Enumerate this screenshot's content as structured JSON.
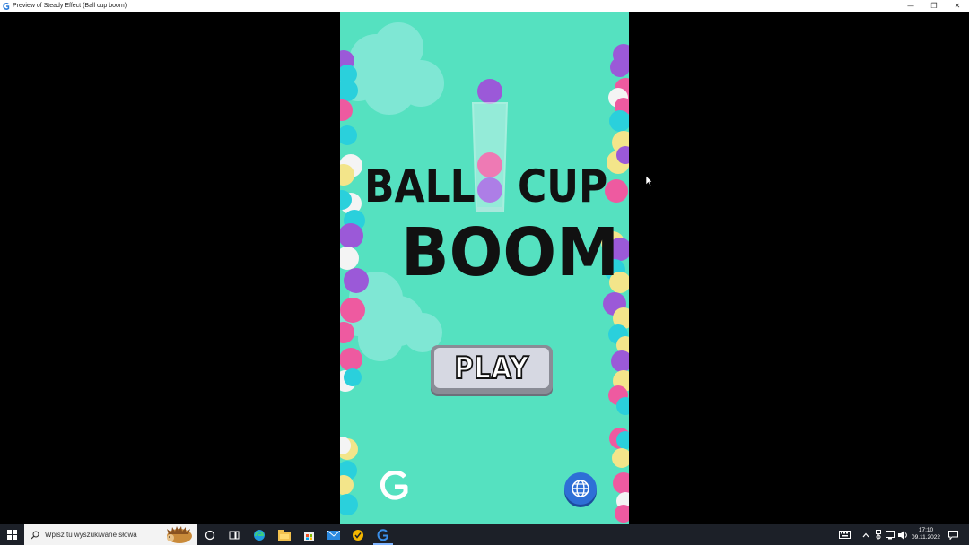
{
  "window": {
    "title": "Preview of Steady Effect (Ball cup boom)",
    "controls": {
      "minimize": "—",
      "restore": "❐",
      "close": "✕"
    }
  },
  "game": {
    "logo": {
      "word1": "BALL",
      "word2": "CUP",
      "word3": "BOOM"
    },
    "play_label": "PLAY",
    "icons": {
      "brand": "g-logo-icon",
      "language": "globe-icon"
    },
    "colors": {
      "background": "#55e1c0",
      "pink": "#ee5aa0",
      "purple": "#9b59d8",
      "cyan": "#2ad0dc",
      "yellow": "#f3e58a",
      "white": "#f4f4f4"
    }
  },
  "taskbar": {
    "search_placeholder": "Wpisz tu wyszukiwane słowa",
    "time": "17:10",
    "date": "09.11.2022",
    "icons": [
      "windows-start-icon",
      "search-icon",
      "cortana-icon",
      "task-view-icon",
      "edge-icon",
      "file-explorer-icon",
      "store-icon",
      "mail-icon",
      "norton-icon",
      "steady-effect-icon",
      "keyboard-icon",
      "chevron-up-icon",
      "usb-icon",
      "network-icon",
      "volume-icon",
      "notifications-icon"
    ]
  }
}
